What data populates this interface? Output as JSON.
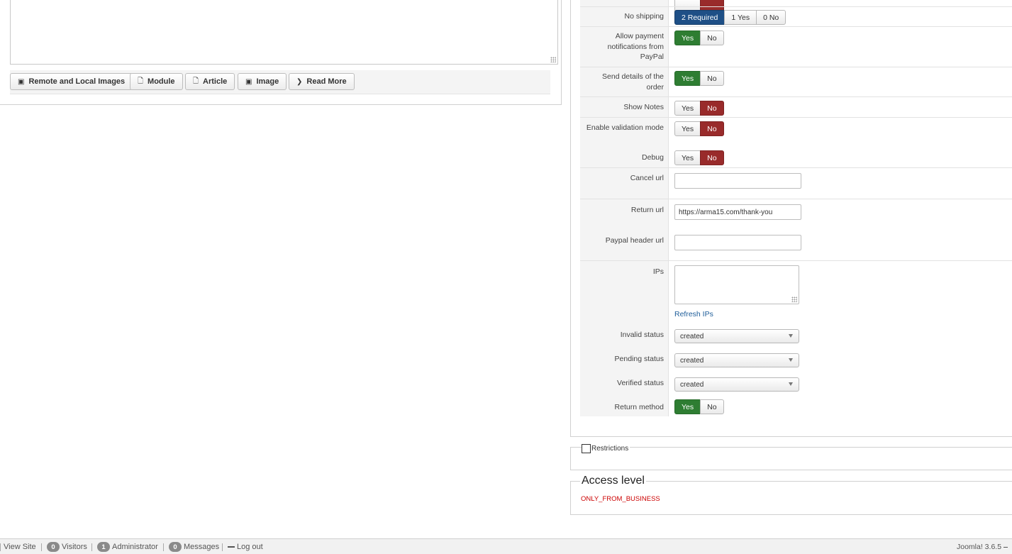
{
  "editor": {
    "buttons": [
      {
        "label": "Remote and Local Images",
        "icon": "picture-icon"
      },
      {
        "label": "Module",
        "icon": "file-add-icon"
      },
      {
        "label": "Article",
        "icon": "file-add-icon"
      },
      {
        "label": "Image",
        "icon": "picture-icon"
      },
      {
        "label": "Read More",
        "icon": "chevron-down-icon"
      }
    ]
  },
  "settings": {
    "no_shipping": {
      "label": "No shipping",
      "options": [
        "2 Required",
        "1 Yes",
        "0 No"
      ],
      "selected": "2 Required"
    },
    "allow_payment_notifications": {
      "label": "Allow payment notifications from PayPal",
      "options": [
        "Yes",
        "No"
      ],
      "selected": "Yes"
    },
    "send_details": {
      "label": "Send details of the order",
      "options": [
        "Yes",
        "No"
      ],
      "selected": "Yes"
    },
    "show_notes": {
      "label": "Show Notes",
      "options": [
        "Yes",
        "No"
      ],
      "selected": "No"
    },
    "enable_validation": {
      "label": "Enable validation mode",
      "options": [
        "Yes",
        "No"
      ],
      "selected": "No"
    },
    "debug": {
      "label": "Debug",
      "options": [
        "Yes",
        "No"
      ],
      "selected": "No"
    },
    "cancel_url": {
      "label": "Cancel url",
      "value": ""
    },
    "return_url": {
      "label": "Return url",
      "value": "https://arma15.com/thank-you"
    },
    "paypal_header_url": {
      "label": "Paypal header url",
      "value": ""
    },
    "ips": {
      "label": "IPs",
      "value": "",
      "refresh_label": "Refresh IPs"
    },
    "invalid_status": {
      "label": "Invalid status",
      "value": "created"
    },
    "pending_status": {
      "label": "Pending status",
      "value": "created"
    },
    "verified_status": {
      "label": "Verified status",
      "value": "created"
    },
    "return_method": {
      "label": "Return method",
      "options": [
        "Yes",
        "No"
      ],
      "selected": "Yes"
    }
  },
  "restrictions": {
    "label": "Restrictions",
    "checked": false
  },
  "access_level": {
    "title": "Access level",
    "value": "ONLY_FROM_BUSINESS"
  },
  "statusbar": {
    "view_site": "View Site",
    "visitors_count": "0",
    "visitors_label": "Visitors",
    "admin_count": "1",
    "admin_label": "Administrator",
    "messages_count": "0",
    "messages_label": "Messages",
    "logout": "Log out",
    "version": "Joomla! 3.6.5"
  },
  "colors": {
    "yes_active": "#2e7d32",
    "no_active": "#992b2b",
    "required_active": "#1e4f86",
    "access_value": "#cc0000"
  }
}
